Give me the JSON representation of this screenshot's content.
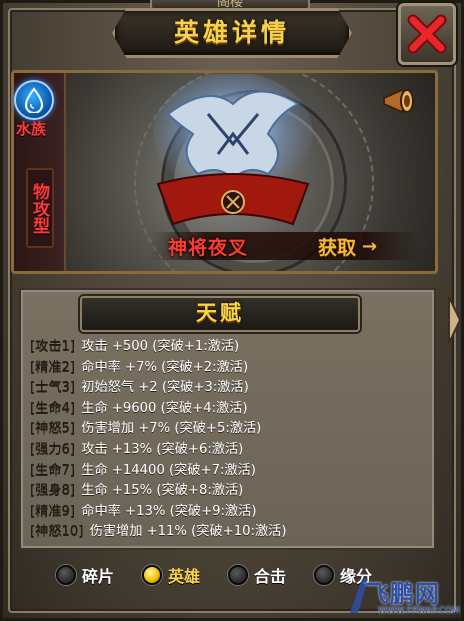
{
  "window": {
    "top_plaque": "阁楼",
    "title": "英雄详情",
    "close_icon": "close-x-icon"
  },
  "hero": {
    "element_icon": "water-drop-icon",
    "element_label": "水族",
    "type_label": "物攻型",
    "name": "神将夜叉",
    "obtain_label": "获取",
    "obtain_arrow": "→",
    "colors": {
      "accent": "#f6d24a",
      "name": "#ff3b2f",
      "element": "#ff3a3a"
    }
  },
  "talent": {
    "title": "天赋",
    "rows": [
      {
        "tag": "[攻击1]",
        "text": "攻击 +500 (突破+1:激活)"
      },
      {
        "tag": "[精准2]",
        "text": "命中率 +7% (突破+2:激活)"
      },
      {
        "tag": "[士气3]",
        "text": "初始怒气 +2 (突破+3:激活)"
      },
      {
        "tag": "[生命4]",
        "text": "生命 +9600 (突破+4:激活)"
      },
      {
        "tag": "[神怒5]",
        "text": "伤害增加 +7% (突破+5:激活)"
      },
      {
        "tag": "[强力6]",
        "text": "攻击 +13% (突破+6:激活)"
      },
      {
        "tag": "[生命7]",
        "text": "生命 +14400 (突破+7:激活)"
      },
      {
        "tag": "[强身8]",
        "text": "生命 +15% (突破+8:激活)"
      },
      {
        "tag": "[精准9]",
        "text": "命中率 +13% (突破+9:激活)"
      },
      {
        "tag": "[神怒10]",
        "text": "伤害增加 +11% (突破+10:激活)"
      }
    ]
  },
  "tabs": [
    {
      "label": "碎片",
      "active": false
    },
    {
      "label": "英雄",
      "active": true
    },
    {
      "label": "合击",
      "active": false
    },
    {
      "label": "缘分",
      "active": false
    }
  ],
  "watermark": {
    "main": "飞鹏网",
    "sub": "WWW.FPWAP.COM"
  }
}
